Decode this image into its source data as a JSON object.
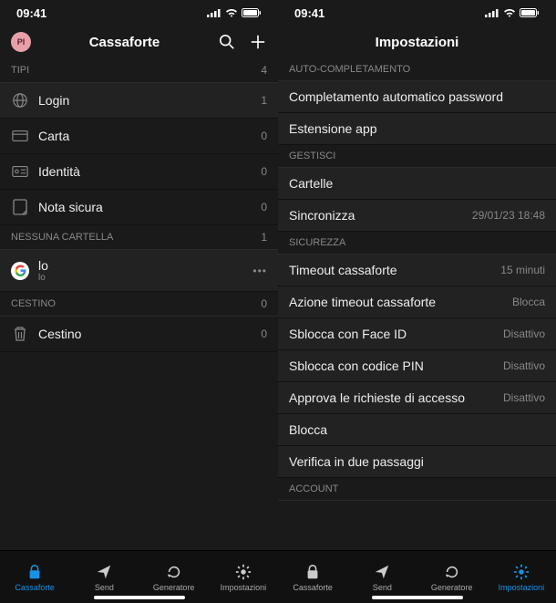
{
  "status": {
    "time": "09:41"
  },
  "left": {
    "avatar_initials": "PI",
    "title": "Cassaforte",
    "sections": {
      "tipi": {
        "header": "TIPI",
        "count": "4",
        "items": [
          {
            "icon": "globe",
            "label": "Login",
            "count": "1"
          },
          {
            "icon": "card",
            "label": "Carta",
            "count": "0"
          },
          {
            "icon": "id",
            "label": "Identità",
            "count": "0"
          },
          {
            "icon": "note",
            "label": "Nota sicura",
            "count": "0"
          }
        ]
      },
      "folders": {
        "header": "NESSUNA CARTELLA",
        "count": "1",
        "items": [
          {
            "icon": "google",
            "label": "lo",
            "sub": "lo",
            "more": "•••"
          }
        ]
      },
      "trash": {
        "header": "CESTINO",
        "count": "0",
        "items": [
          {
            "icon": "trash",
            "label": "Cestino",
            "count": "0"
          }
        ]
      }
    }
  },
  "right": {
    "title": "Impostazioni",
    "groups": {
      "auto": {
        "header": "AUTO-COMPLETAMENTO",
        "items": [
          {
            "label": "Completamento automatico password"
          },
          {
            "label": "Estensione app"
          }
        ]
      },
      "manage": {
        "header": "GESTISCI",
        "items": [
          {
            "label": "Cartelle"
          },
          {
            "label": "Sincronizza",
            "value": "29/01/23 18:48"
          }
        ]
      },
      "security": {
        "header": "SICUREZZA",
        "items": [
          {
            "label": "Timeout cassaforte",
            "value": "15 minuti"
          },
          {
            "label": "Azione timeout cassaforte",
            "value": "Blocca"
          },
          {
            "label": "Sblocca con Face ID",
            "value": "Disattivo"
          },
          {
            "label": "Sblocca con codice PIN",
            "value": "Disattivo"
          },
          {
            "label": "Approva le richieste di accesso",
            "value": "Disattivo"
          },
          {
            "label": "Blocca"
          },
          {
            "label": "Verifica in due passaggi"
          }
        ]
      },
      "account": {
        "header": "ACCOUNT"
      }
    }
  },
  "tabs": [
    {
      "icon": "lock",
      "label": "Cassaforte"
    },
    {
      "icon": "send",
      "label": "Send"
    },
    {
      "icon": "gen",
      "label": "Generatore"
    },
    {
      "icon": "gear",
      "label": "Impostazioni"
    }
  ]
}
